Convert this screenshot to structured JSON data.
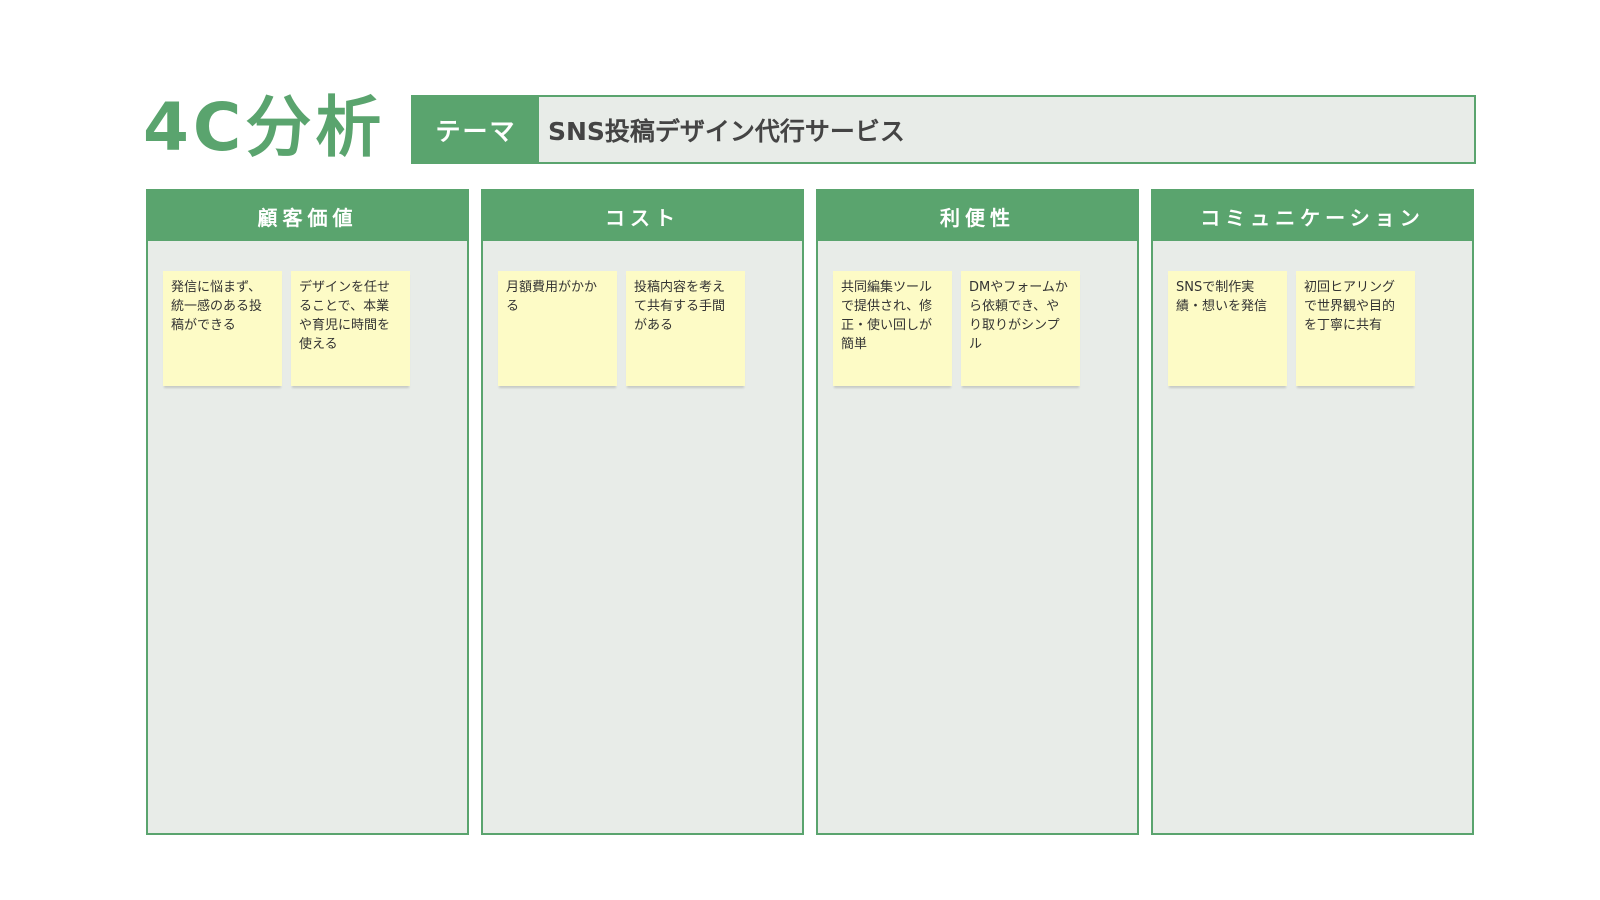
{
  "title": "4C分析",
  "theme": {
    "label": "テーマ",
    "value": "SNS投稿デザイン代行サービス"
  },
  "columns": [
    {
      "header": "顧客価値",
      "notes": [
        "発信に悩まず、統一感のある投稿ができる",
        "デザインを任せることで、本業や育児に時間を使える"
      ]
    },
    {
      "header": "コスト",
      "notes": [
        "月額費用がかかる",
        "投稿内容を考えて共有する手間がある"
      ]
    },
    {
      "header": "利便性",
      "notes": [
        "共同編集ツールで提供され、修正・使い回しが簡単",
        "DMやフォームから依頼でき、やり取りがシンプル"
      ]
    },
    {
      "header": "コミュニケーション",
      "notes": [
        "SNSで制作実績・想いを発信",
        "初回ヒアリングで世界観や目的を丁寧に共有"
      ]
    }
  ],
  "colors": {
    "accent": "#5aa46e",
    "panel": "#e8ece8",
    "sticky": "#fdfbc6"
  }
}
